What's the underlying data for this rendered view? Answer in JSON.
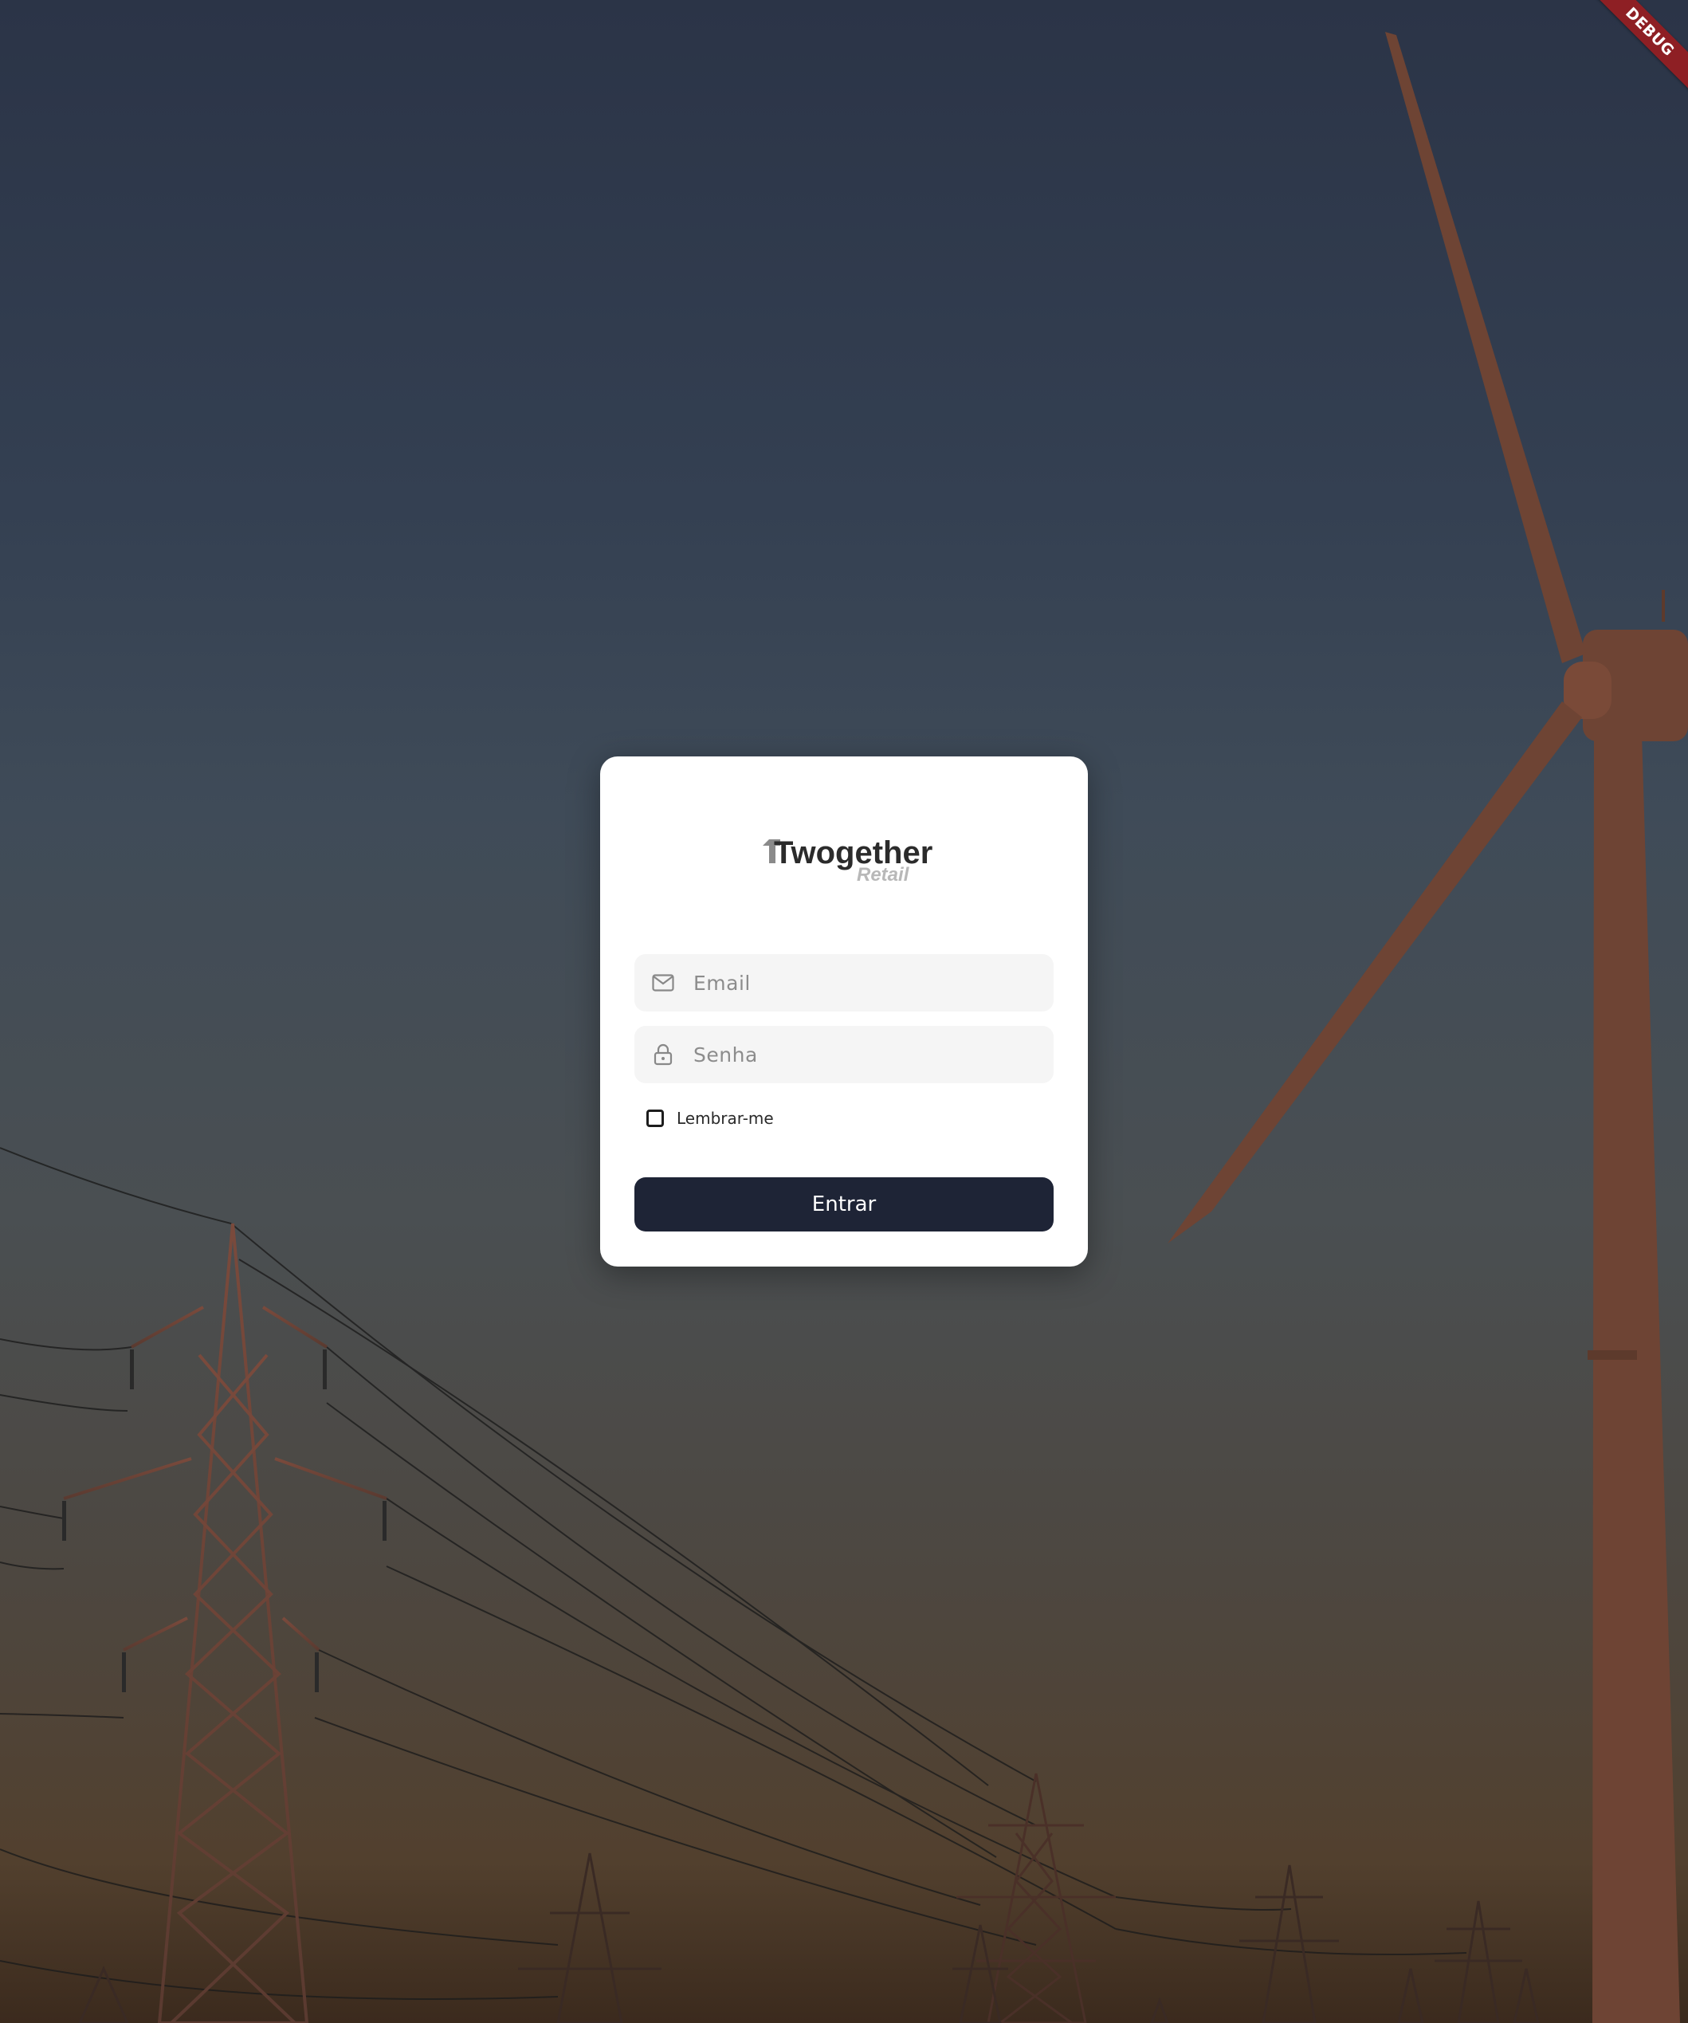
{
  "debug_banner": {
    "label": "DEBUG"
  },
  "logo": {
    "brand": "Twogether",
    "sub": "Retail"
  },
  "login": {
    "email_placeholder": "Email",
    "password_placeholder": "Senha",
    "remember_label": "Lembrar-me",
    "remember_checked": false,
    "submit_label": "Entrar"
  },
  "colors": {
    "button": "#1e2436",
    "field_bg": "#f5f5f5",
    "debug_ribbon": "#8e1f24"
  },
  "icons": {
    "email": "mail-icon",
    "password": "lock-icon"
  }
}
